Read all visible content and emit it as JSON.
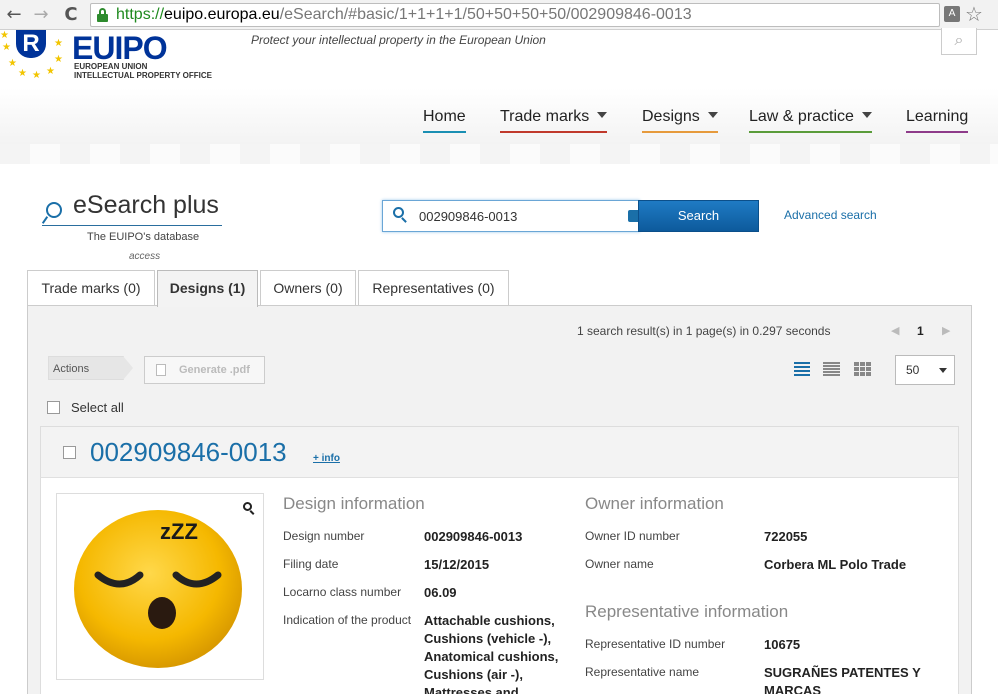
{
  "browser": {
    "url_scheme": "https://",
    "url_host": "euipo.europa.eu",
    "url_path": "/eSearch/#basic/1+1+1+1/50+50+50+50/002909846-0013",
    "back": "←",
    "forward": "→",
    "reload": "C"
  },
  "header": {
    "logo_letter": "R",
    "logo_text": "EUIPO",
    "logo_sub_line1": "EUROPEAN UNION",
    "logo_sub_line2": "INTELLECTUAL PROPERTY OFFICE",
    "tagline": "Protect your intellectual property in the European Union"
  },
  "nav": {
    "items": [
      {
        "label": "Home",
        "color": "#1a8fb3"
      },
      {
        "label": "Trade marks",
        "color": "#c0392b"
      },
      {
        "label": "Designs",
        "color": "#e69a3c"
      },
      {
        "label": "Law & practice",
        "color": "#5a9c3a"
      },
      {
        "label": "Learning",
        "color": "#8e3b8a"
      }
    ]
  },
  "esearch": {
    "title": "eSearch plus",
    "subtitle_line1": "The EUIPO's database",
    "subtitle_line2": "access",
    "search_value": "002909846-0013",
    "search_button": "Search",
    "advanced_link": "Advanced search"
  },
  "tabs": [
    {
      "label": "Trade marks (0)"
    },
    {
      "label": "Designs (1)"
    },
    {
      "label": "Owners (0)"
    },
    {
      "label": "Representatives (0)"
    }
  ],
  "results": {
    "count_text": "1 search result(s) in 1 page(s) in 0.297 seconds",
    "page": "1",
    "actions_label": "Actions",
    "generate_pdf": "Generate .pdf",
    "per_page": "50",
    "select_all": "Select all"
  },
  "design": {
    "id": "002909846-0013",
    "info_link": "+ info",
    "emoji_text": "zZZ",
    "design_info_title": "Design information",
    "design_number_label": "Design number",
    "design_number_value": "002909846-0013",
    "filing_date_label": "Filing date",
    "filing_date_value": "15/12/2015",
    "locarno_label": "Locarno class number",
    "locarno_value": "06.09",
    "indication_label": "Indication of the product",
    "indication_lines": [
      "Attachable cushions,",
      "Cushions (vehicle -),",
      "Anatomical cushions,",
      "Cushions (air -),",
      "Mattresses and"
    ],
    "owner_info_title": "Owner information",
    "owner_id_label": "Owner ID number",
    "owner_id_value": "722055",
    "owner_name_label": "Owner name",
    "owner_name_value": "Corbera ML Polo Trade",
    "rep_info_title": "Representative information",
    "rep_id_label": "Representative ID number",
    "rep_id_value": "10675",
    "rep_name_label": "Representative name",
    "rep_name_line1": "SUGRAÑES PATENTES Y",
    "rep_name_line2": "MARCAS"
  }
}
